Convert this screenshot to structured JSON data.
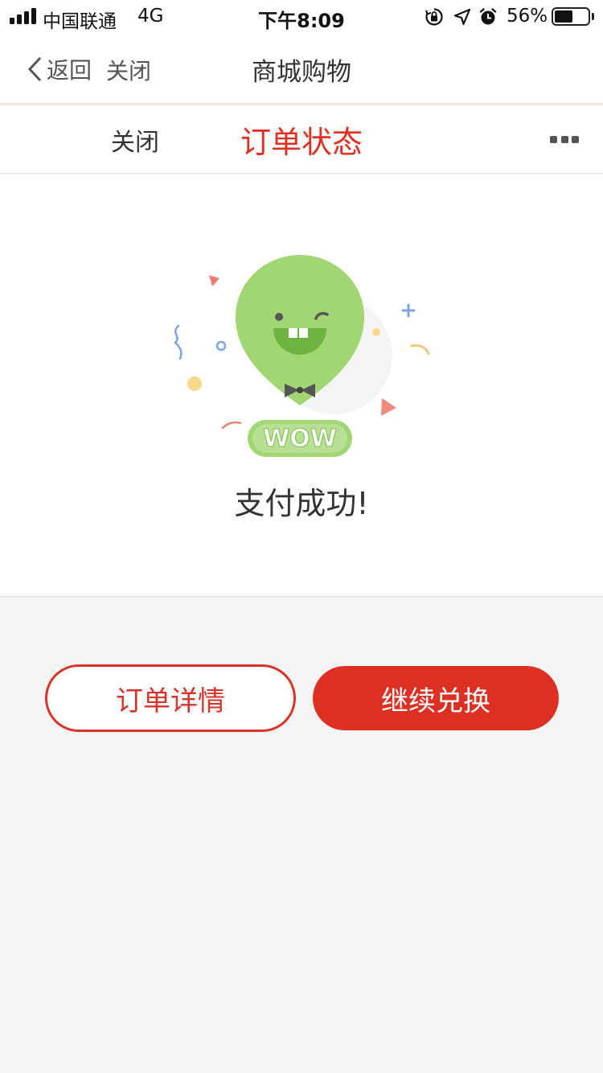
{
  "status_bar": {
    "carrier": "中国联通",
    "network": "4G",
    "time": "下午8:09",
    "battery_percent": "56%",
    "battery_level": 0.56,
    "icons": [
      "signal-bars-icon",
      "orientation-lock-icon",
      "location-arrow-icon",
      "alarm-icon",
      "battery-icon"
    ]
  },
  "nav_bar": {
    "back_label": "返回",
    "close_label": "关闭",
    "title": "商城购物"
  },
  "page_header": {
    "close_label": "关闭",
    "title": "订单状态",
    "more_icon": "more-dots-icon"
  },
  "success": {
    "badge_text": "WOW",
    "message": "支付成功!"
  },
  "actions": {
    "order_detail_label": "订单详情",
    "continue_label": "继续兑换"
  },
  "colors": {
    "accent_red": "#dc3122",
    "balloon_green": "#a1d672",
    "page_background": "#f4f4f4"
  }
}
